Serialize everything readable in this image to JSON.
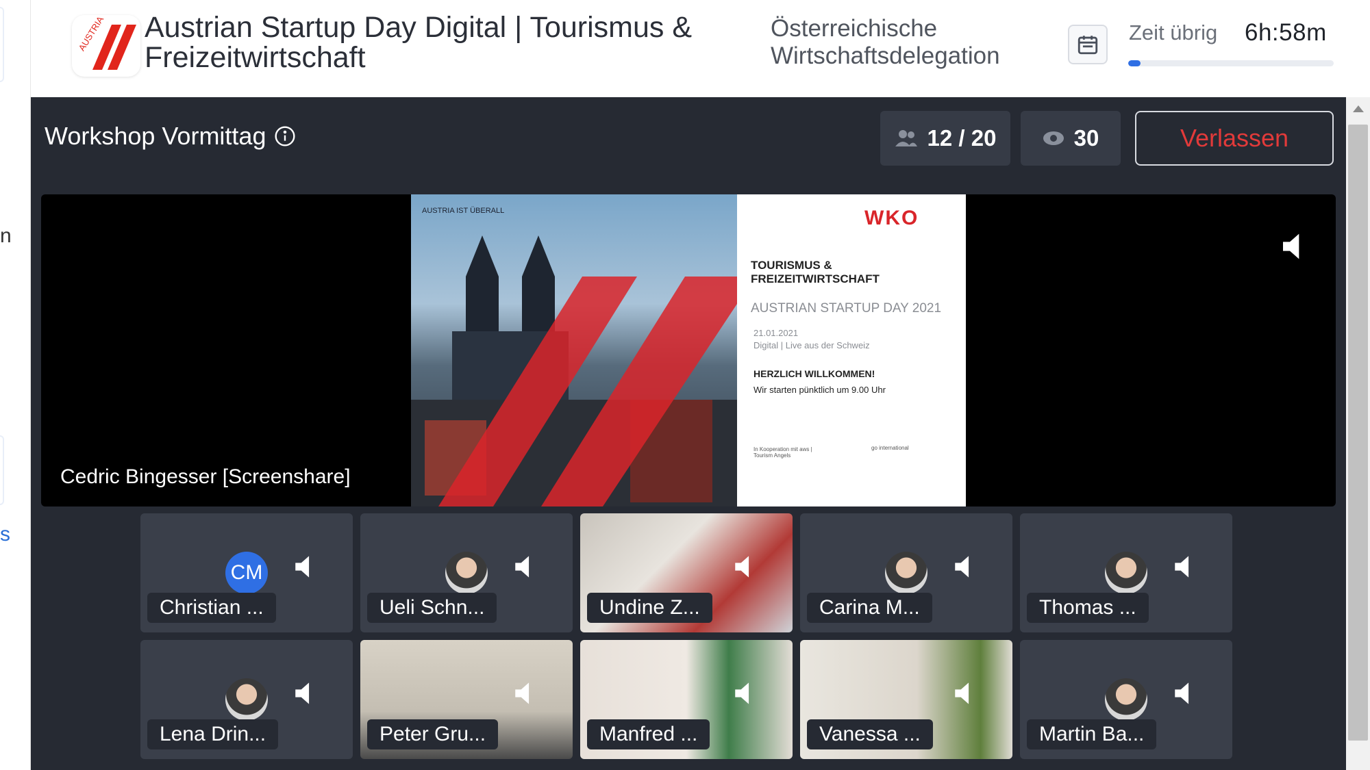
{
  "header": {
    "event_title": "Austrian Startup Day Digital | Tourismus & Freizeitwirtschaft",
    "logo_text": "AUSTRIA",
    "organizer": "Österreichische Wirtschaftsdelegation",
    "calendar_icon": "calendar-icon",
    "time_label": "Zeit übrig",
    "time_value": "6h:58m",
    "time_progress": 0.06,
    "accent_color": "#2f6fe4"
  },
  "left_strip": {
    "fragment_top": "n",
    "fragment_link": "s"
  },
  "room": {
    "title": "Workshop Vormittag",
    "participants": "12 / 20",
    "viewers": "30",
    "leave_label": "Verlassen",
    "leave_color": "#e23a3a"
  },
  "stage": {
    "presenter": "Cedric Bingesser [Screenshare]",
    "slide": {
      "photo_tag": "AUSTRIA IST ÜBERALL",
      "brand": "WKO",
      "headline": "TOURISMUS & FREIZEITWIRTSCHAFT",
      "event": "AUSTRIAN STARTUP DAY 2021",
      "date": "21.01.2021",
      "subline": "Digital | Live aus der Schweiz",
      "welcome": "HERZLICH WILLKOMMEN!",
      "start": "Wir starten pünktlich um 9.00 Uhr",
      "coop_left": "In Kooperation mit aws | Tourism Angels",
      "coop_right": "go international"
    }
  },
  "tiles": [
    {
      "name": "Christian ...",
      "type": "initials",
      "initials": "CM"
    },
    {
      "name": "Ueli Schn...",
      "type": "photo"
    },
    {
      "name": "Undine Z...",
      "type": "video"
    },
    {
      "name": "Carina M...",
      "type": "photo"
    },
    {
      "name": "Thomas ...",
      "type": "photo"
    },
    {
      "name": "Lena Drin...",
      "type": "photo"
    },
    {
      "name": "Peter Gru...",
      "type": "video"
    },
    {
      "name": "Manfred ...",
      "type": "video"
    },
    {
      "name": "Vanessa ...",
      "type": "video"
    },
    {
      "name": "Martin Ba...",
      "type": "photo"
    }
  ]
}
